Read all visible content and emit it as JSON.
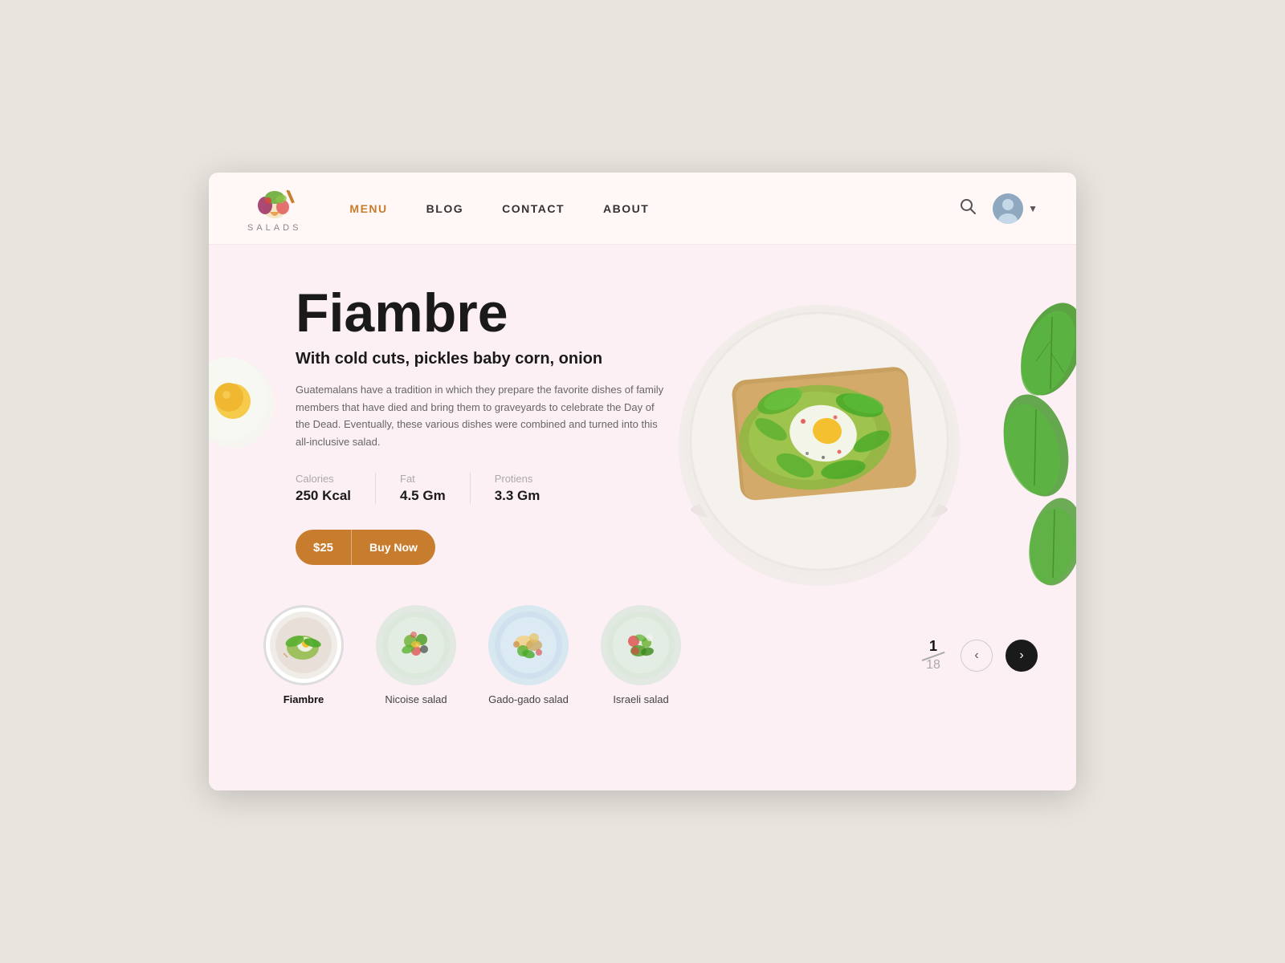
{
  "brand": {
    "name": "SALADS",
    "logo_alt": "Salads Logo"
  },
  "nav": {
    "links": [
      {
        "id": "menu",
        "label": "MENU",
        "active": true
      },
      {
        "id": "blog",
        "label": "BLOG",
        "active": false
      },
      {
        "id": "contact",
        "label": "CONTACT",
        "active": false
      },
      {
        "id": "about",
        "label": "ABOUT",
        "active": false
      }
    ]
  },
  "hero": {
    "title": "Fiambre",
    "subtitle": "With cold cuts, pickles baby corn, onion",
    "description": "Guatemalans have a tradition in which they prepare the favorite dishes of family members that have died and bring them to graveyards to celebrate the Day of the Dead. Eventually, these various dishes were combined and turned into this all-inclusive salad.",
    "nutrition": [
      {
        "label": "Calories",
        "value": "250 Kcal"
      },
      {
        "label": "Fat",
        "value": "4.5 Gm"
      },
      {
        "label": "Protiens",
        "value": "3.3 Gm"
      }
    ],
    "price": "$25",
    "buy_label": "Buy Now"
  },
  "thumbnails": [
    {
      "id": "fiambre",
      "label": "Fiambre",
      "active": true,
      "bg": "#f0ede8"
    },
    {
      "id": "nicoise",
      "label": "Nicoise salad",
      "active": false,
      "bg": "#e8ede8"
    },
    {
      "id": "gado",
      "label": "Gado-gado salad",
      "active": false,
      "bg": "#dde8ee"
    },
    {
      "id": "israeli",
      "label": "Israeli salad",
      "active": false,
      "bg": "#e8ede8"
    }
  ],
  "pagination": {
    "current": "1",
    "total": "18"
  }
}
